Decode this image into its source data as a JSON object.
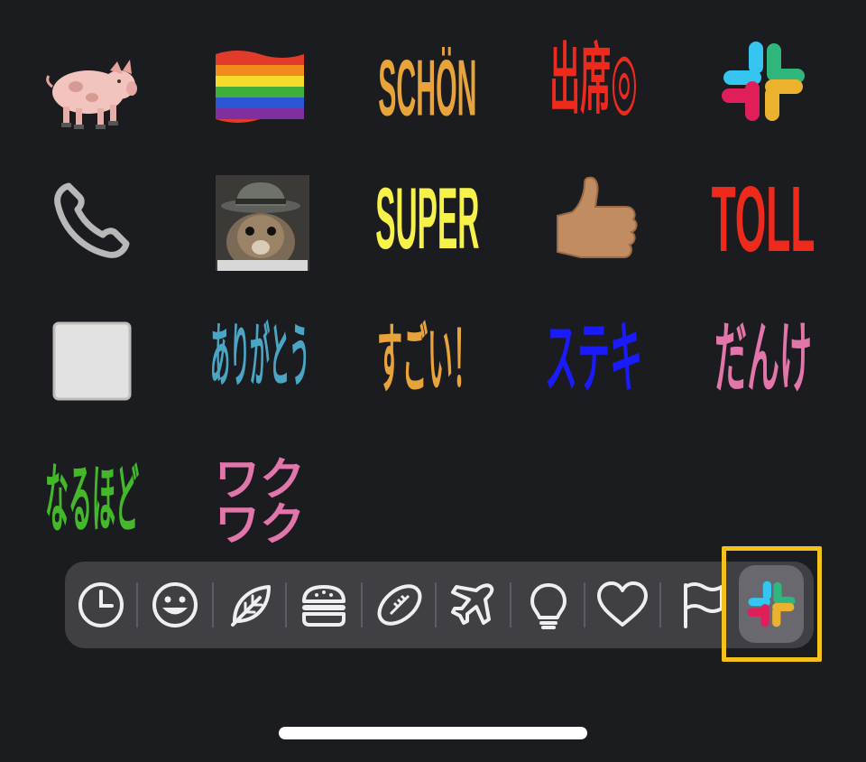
{
  "emoji_grid": {
    "row1": {
      "schon": "SCHÖN",
      "shusseki": "出席◎"
    },
    "row2": {
      "super": "SUPER",
      "toll": "TOLL"
    },
    "row3": {
      "arigatou": "ありがとう",
      "sugoi": "すごい！",
      "suteki": "ステキ",
      "dannke": "だんけ"
    },
    "row4": {
      "naruhodo": "なるほど",
      "waku_line1": "ワク",
      "waku_line2": "ワク"
    }
  },
  "category_bar": {
    "tabs": [
      "recent-icon",
      "smileys-icon",
      "nature-icon",
      "food-icon",
      "activity-icon",
      "travel-icon",
      "objects-icon",
      "symbols-icon",
      "flags-icon",
      "slack-icon"
    ],
    "selected": "slack-icon"
  },
  "colors": {
    "background": "#1b1c20",
    "bar": "#3f3f44",
    "highlight": "#f2c21b",
    "orange": "#e8a33a",
    "red": "#ee2a1d",
    "yellow": "#f6f24a",
    "teal": "#4aa6c4",
    "blue": "#1a1aff",
    "pink": "#e276ab",
    "green": "#44b82a"
  }
}
